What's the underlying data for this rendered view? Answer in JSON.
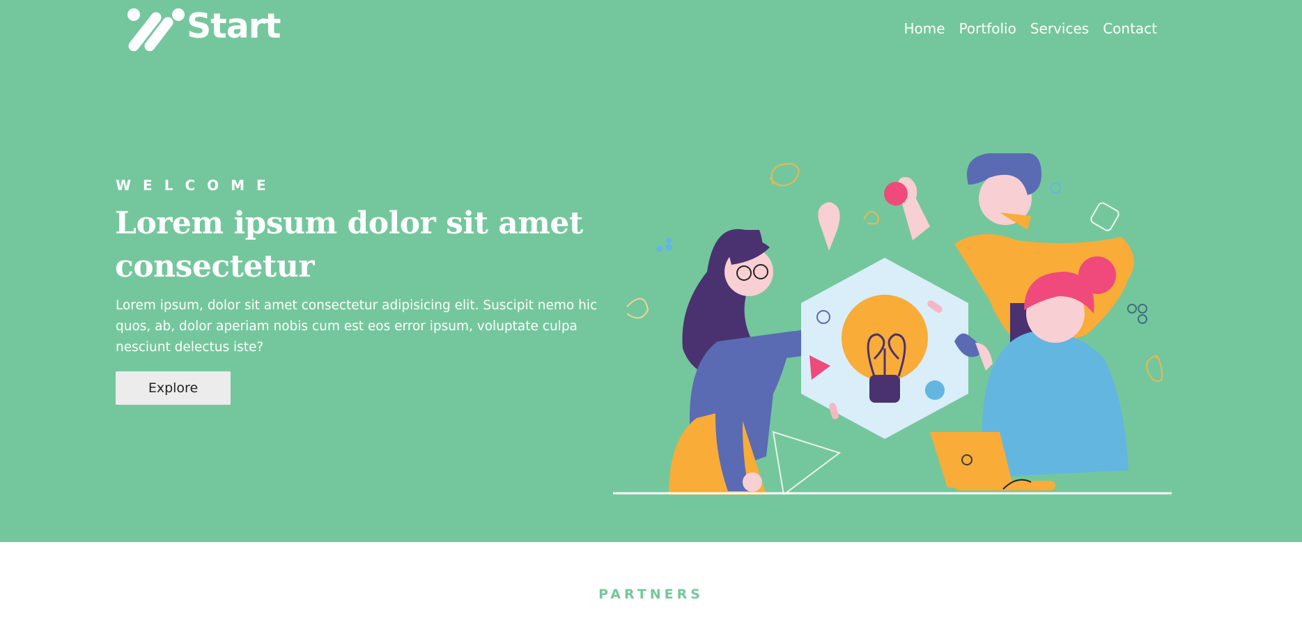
{
  "brand": {
    "name": "Start",
    "primary_color": "#74c79c",
    "text_color": "#ffffff"
  },
  "nav": {
    "items": [
      {
        "label": "Home"
      },
      {
        "label": "Portfolio"
      },
      {
        "label": "Services"
      },
      {
        "label": "Contact"
      }
    ]
  },
  "hero": {
    "eyebrow": "WELCOME",
    "headline": "Lorem ipsum dolor sit amet consectetur",
    "lead": "Lorem ipsum, dolor sit amet consectetur adipisicing elit. Suscipit nemo hic quos, ab, dolor aperiam nobis cum est eos error ipsum, voluptate culpa nesciunt delectus iste?",
    "cta_label": "Explore"
  },
  "illustration": {
    "icon": "team-idea-lightbulb-illustration",
    "colors": {
      "orange": "#f9ac38",
      "blue": "#5a6bb4",
      "pink": "#ef4a7b",
      "light_blue": "#63b6e0",
      "purple": "#4a3270",
      "pale": "#d9eef9"
    }
  },
  "partners": {
    "heading": "PARTNERS"
  }
}
